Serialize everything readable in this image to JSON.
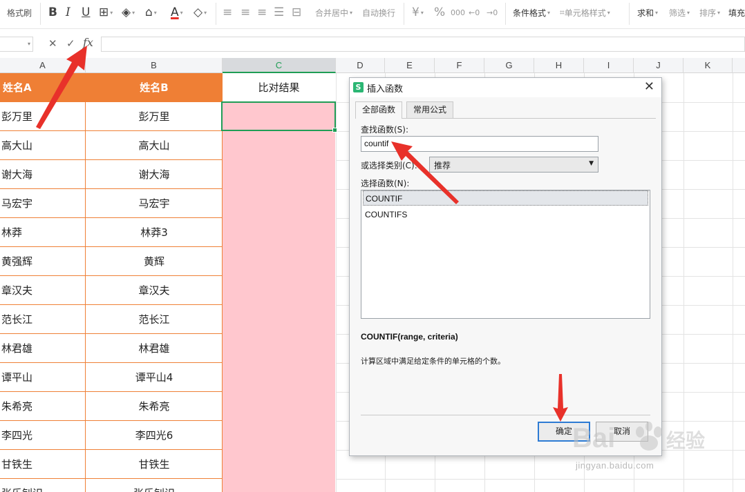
{
  "ribbon": {
    "format_painter": "格式刷",
    "bold": "B",
    "italic": "I",
    "underline": "U",
    "merge_center": "合并居中",
    "wrap_text": "自动换行",
    "currency": "¥",
    "percent": "%",
    "thousands": "000",
    "conditional_format": "条件格式",
    "cell_style": "单元格样式",
    "sum": "求和",
    "filter": "筛选",
    "sort": "排序",
    "fill": "填充"
  },
  "formula_bar": {
    "cancel": "✕",
    "confirm": "✓",
    "fx": "fx",
    "value": ""
  },
  "columns": [
    "A",
    "B",
    "C",
    "D",
    "E",
    "F",
    "G",
    "H",
    "I",
    "J",
    "K"
  ],
  "selected_column": "C",
  "header_row": {
    "a": "姓名A",
    "b": "姓名B",
    "c": "比对结果"
  },
  "rows": [
    {
      "a": "彭万里",
      "b": "彭万里"
    },
    {
      "a": "高大山",
      "b": "高大山"
    },
    {
      "a": "谢大海",
      "b": "谢大海"
    },
    {
      "a": "马宏宇",
      "b": "马宏宇"
    },
    {
      "a": "林莽",
      "b": "林莽3"
    },
    {
      "a": "黄强辉",
      "b": "黄辉"
    },
    {
      "a": "章汉夫",
      "b": "章汉夫"
    },
    {
      "a": "范长江",
      "b": "范长江"
    },
    {
      "a": "林君雄",
      "b": "林君雄"
    },
    {
      "a": "谭平山",
      "b": "谭平山4"
    },
    {
      "a": "朱希亮",
      "b": "朱希亮"
    },
    {
      "a": "李四光",
      "b": "李四光6"
    },
    {
      "a": "甘铁生",
      "b": "甘铁生"
    },
    {
      "a": "张乐钊识",
      "b": "张乐钊识"
    }
  ],
  "dialog": {
    "title": "插入函数",
    "close": "✕",
    "logo": "S",
    "tabs": [
      "全部函数",
      "常用公式"
    ],
    "search_label": "查找函数(S):",
    "search_value": "countif",
    "category_label": "或选择类别(C):",
    "category_value": "推荐",
    "list_label": "选择函数(N):",
    "functions": [
      "COUNTIF",
      "COUNTIFS"
    ],
    "selected_function": "COUNTIF",
    "signature": "COUNTIF(range, criteria)",
    "description": "计算区域中满足给定条件的单元格的个数。",
    "ok": "确定",
    "cancel": "取消"
  },
  "watermark": {
    "brand": "Bai",
    "brand_cn": "经验",
    "url": "jingyan.baidu.com"
  },
  "colors": {
    "header_orange": "#ef7f35",
    "pink_fill": "#ffc7ce",
    "selection_green": "#1f9d55",
    "arrow_red": "#e8312a",
    "ok_border": "#2d7bd4"
  }
}
